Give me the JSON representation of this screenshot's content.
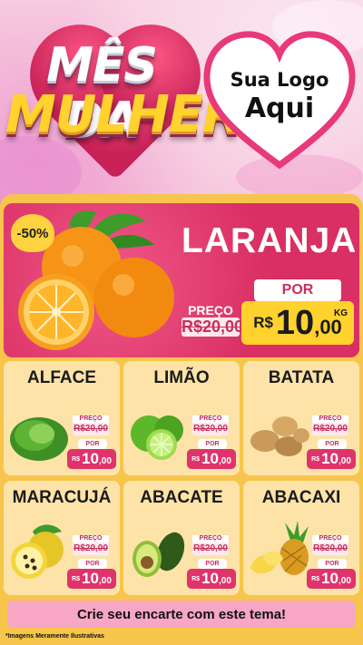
{
  "header": {
    "title_line1": "MÊS DA",
    "title_line2": "MULHER",
    "logo_line1": "Sua Logo",
    "logo_line2": "Aqui"
  },
  "featured": {
    "badge": "-50%",
    "name": "LARANJA",
    "preco_label": "PREÇO",
    "old_price": "R$20,00",
    "por_label": "POR",
    "currency": "R$",
    "price_int": "10",
    "price_dec": ",00",
    "unit": "KG",
    "image": "orange-icon"
  },
  "products": [
    {
      "name": "ALFACE",
      "image": "lettuce-icon",
      "preco_label": "PREÇO",
      "old_price": "R$20,00",
      "por_label": "POR",
      "currency": "R$",
      "price_int": "10",
      "price_dec": ",00"
    },
    {
      "name": "LIMÃO",
      "image": "lime-icon",
      "preco_label": "PREÇO",
      "old_price": "R$20,00",
      "por_label": "POR",
      "currency": "R$",
      "price_int": "10",
      "price_dec": ",00"
    },
    {
      "name": "BATATA",
      "image": "potato-icon",
      "preco_label": "PREÇO",
      "old_price": "R$20,00",
      "por_label": "POR",
      "currency": "R$",
      "price_int": "10",
      "price_dec": ",00"
    },
    {
      "name": "MARACUJÁ",
      "image": "passion-fruit-icon",
      "preco_label": "PREÇO",
      "old_price": "R$20,00",
      "por_label": "POR",
      "currency": "R$",
      "price_int": "10",
      "price_dec": ",00"
    },
    {
      "name": "ABACATE",
      "image": "avocado-icon",
      "preco_label": "PREÇO",
      "old_price": "R$20,00",
      "por_label": "POR",
      "currency": "R$",
      "price_int": "10",
      "price_dec": ",00"
    },
    {
      "name": "ABACAXI",
      "image": "pineapple-icon",
      "preco_label": "PREÇO",
      "old_price": "R$20,00",
      "por_label": "POR",
      "currency": "R$",
      "price_int": "10",
      "price_dec": ",00"
    }
  ],
  "cta": "Crie seu encarte com este tema!",
  "footer": "*Imagens Meramente Ilustrativas",
  "colors": {
    "background": "#f4b7d3",
    "board": "#f7c54b",
    "hero": "#e03a6d",
    "card": "#fde3a8",
    "price_pink": "#e0336b",
    "price_yellow": "#ffd22e"
  }
}
